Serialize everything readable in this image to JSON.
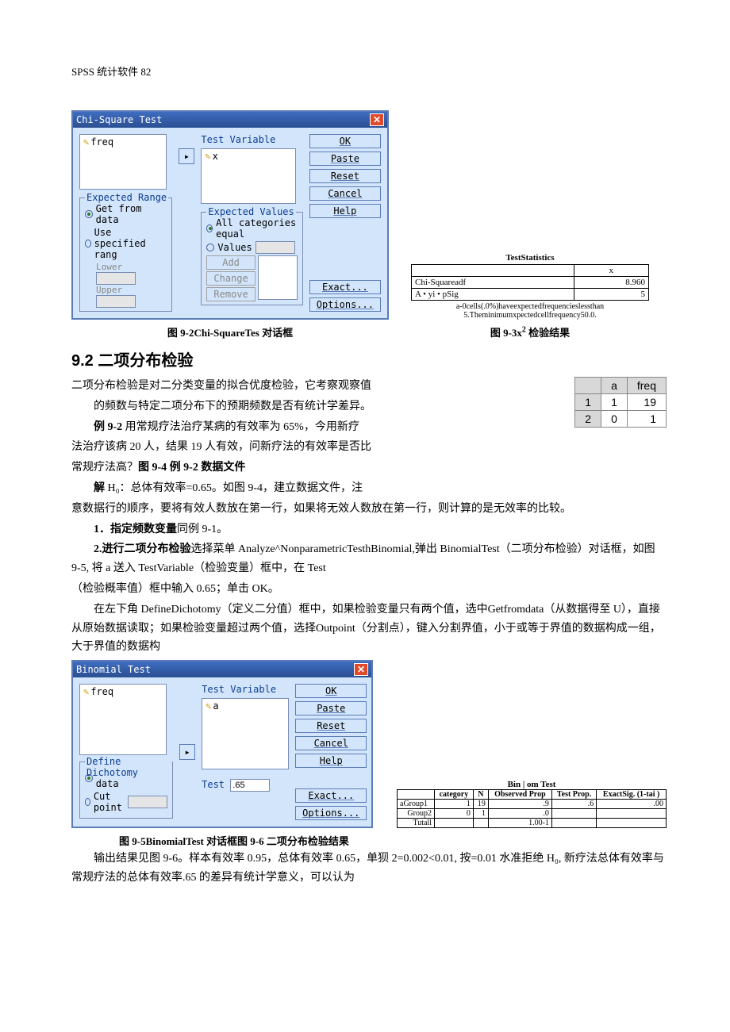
{
  "header": "SPSS 统计软件 82",
  "dialog1": {
    "title": "Chi-Square Test",
    "source_item": "freq",
    "var_label": "Test Variable",
    "var_item": "x",
    "buttons": {
      "ok": "OK",
      "paste": "Paste",
      "reset": "Reset",
      "cancel": "Cancel",
      "help": "Help",
      "exact": "Exact...",
      "options": "Options..."
    },
    "range": {
      "title": "Expected Range",
      "opt1": "Get from data",
      "opt2": "Use specified rang",
      "lower": "Lower",
      "upper": "Upper"
    },
    "values": {
      "title": "Expected Values",
      "opt1": "All categories equal",
      "opt2": "Values",
      "add": "Add",
      "change": "Change",
      "remove": "Remove"
    }
  },
  "fig1_caption": "图 9-2Chi-SquareTes 对话框",
  "stats1": {
    "title": "TestStatistics",
    "col": "x",
    "row1": "Chi-Squareadf",
    "row2": "A • yi • pSig",
    "val1": "8.960",
    "val2": "5",
    "footnote": "a-0cells(.0%)haveexpectedfrequencieslessthan 5.Theminimumxpectedcellfrequency50.0."
  },
  "fig2_prefix": "图 9-3x",
  "fig2_sup": "2",
  "fig2_suffix": " 检验结果",
  "section_title": "9.2 二项分布检验",
  "body": {
    "p1": "二项分布检验是对二分类变量的拟合优度检验，它考察观察值",
    "p1b": "的频数与特定二项分布下的预期频数是否有统计学差异。",
    "ex_label": "例 9-2 ",
    "ex_text": "用常规疗法治疗某病的有效率为 65%，今用新疗",
    "p2": "法治疗该病 20 人，结果 19 人有效，问新疗法的有效率是否比",
    "p3_a": "常规疗法高？",
    "p3_b": "图 9-4 例 9-2 数据文件",
    "sol_label": "解 ",
    "sol_text": "H₀：总体有效率=0.65。如图 9-4，建立数据文件，注",
    "p4": "意数据行的顺序，要将有效人数放在第一行，如果将无效人数放在第一行，则计算的是无效率的比较。",
    "step1_label": "1．指定频数变量",
    "step1_text": "同例 9-1。",
    "step2_label": "2.进行二项分布检验",
    "step2_text": "选择菜单 Analyze^NonparametricTesthBinomial,弹出 BinomialTest（二项分布检验）对话框，如图 9-5, 将 a 送入 TestVariable（检验变量）框中，在 Test",
    "step2_text2": "（检验概率值）框中输入 0.65；单击 OK。",
    "p5": "在左下角 DefineDichotomy（定义二分值）框中，如果检验变量只有两个值，选中Getfromdata（从数据得至 U），直接从原始数据读取；如果检验变量超过两个值，选择Outpoint（分割点），键入分割界值，小于或等于界值的数据构成一组，大于界值的数据构"
  },
  "mini_table": {
    "h1": "a",
    "h2": "freq",
    "r1c1": "1",
    "r1c2": "1",
    "r1c3": "19",
    "r2c1": "2",
    "r2c2": "0",
    "r2c3": "1"
  },
  "dialog2": {
    "title": "Binomial Test",
    "source_item": "freq",
    "var_label": "Test Variable",
    "var_item": "a",
    "test_label": "Test",
    "test_value": ".65",
    "dich": {
      "title": "Define Dichotomy",
      "opt1": "Get from data",
      "opt2": "Cut point"
    }
  },
  "bin_result": {
    "title": "Bin | om Test",
    "h_cat": "category",
    "h_n": "N",
    "h_obs": "Observed Prop",
    "h_test": "Test Prop.",
    "h_sig": "ExactSig. (1-tai )",
    "r1": "aGroup1",
    "r1cat": "1",
    "r1n": "19",
    "r1obs": ".9",
    "r1test": ".6",
    "r1sig": ".00",
    "r2": "Group2",
    "r2cat": "0",
    "r2n": "1",
    "r2obs": ".0",
    "r3": "Tutall",
    "r3n": "",
    "r3obs": "1.00-1"
  },
  "fig3_caption": "图 9-5BinomialTest 对话框图 9-6 二项分布检验结果",
  "conclusion": {
    "p1": "输出结果见图 9-6。样本有效率 0.95，总体有效率 0.65，单狈 2=0.002<0.01, 按=0.01 水准拒绝 H₀, 新疗法总体有效率与常规疗法的总体有效率.65 的差异有统计学意义，可以认为"
  }
}
